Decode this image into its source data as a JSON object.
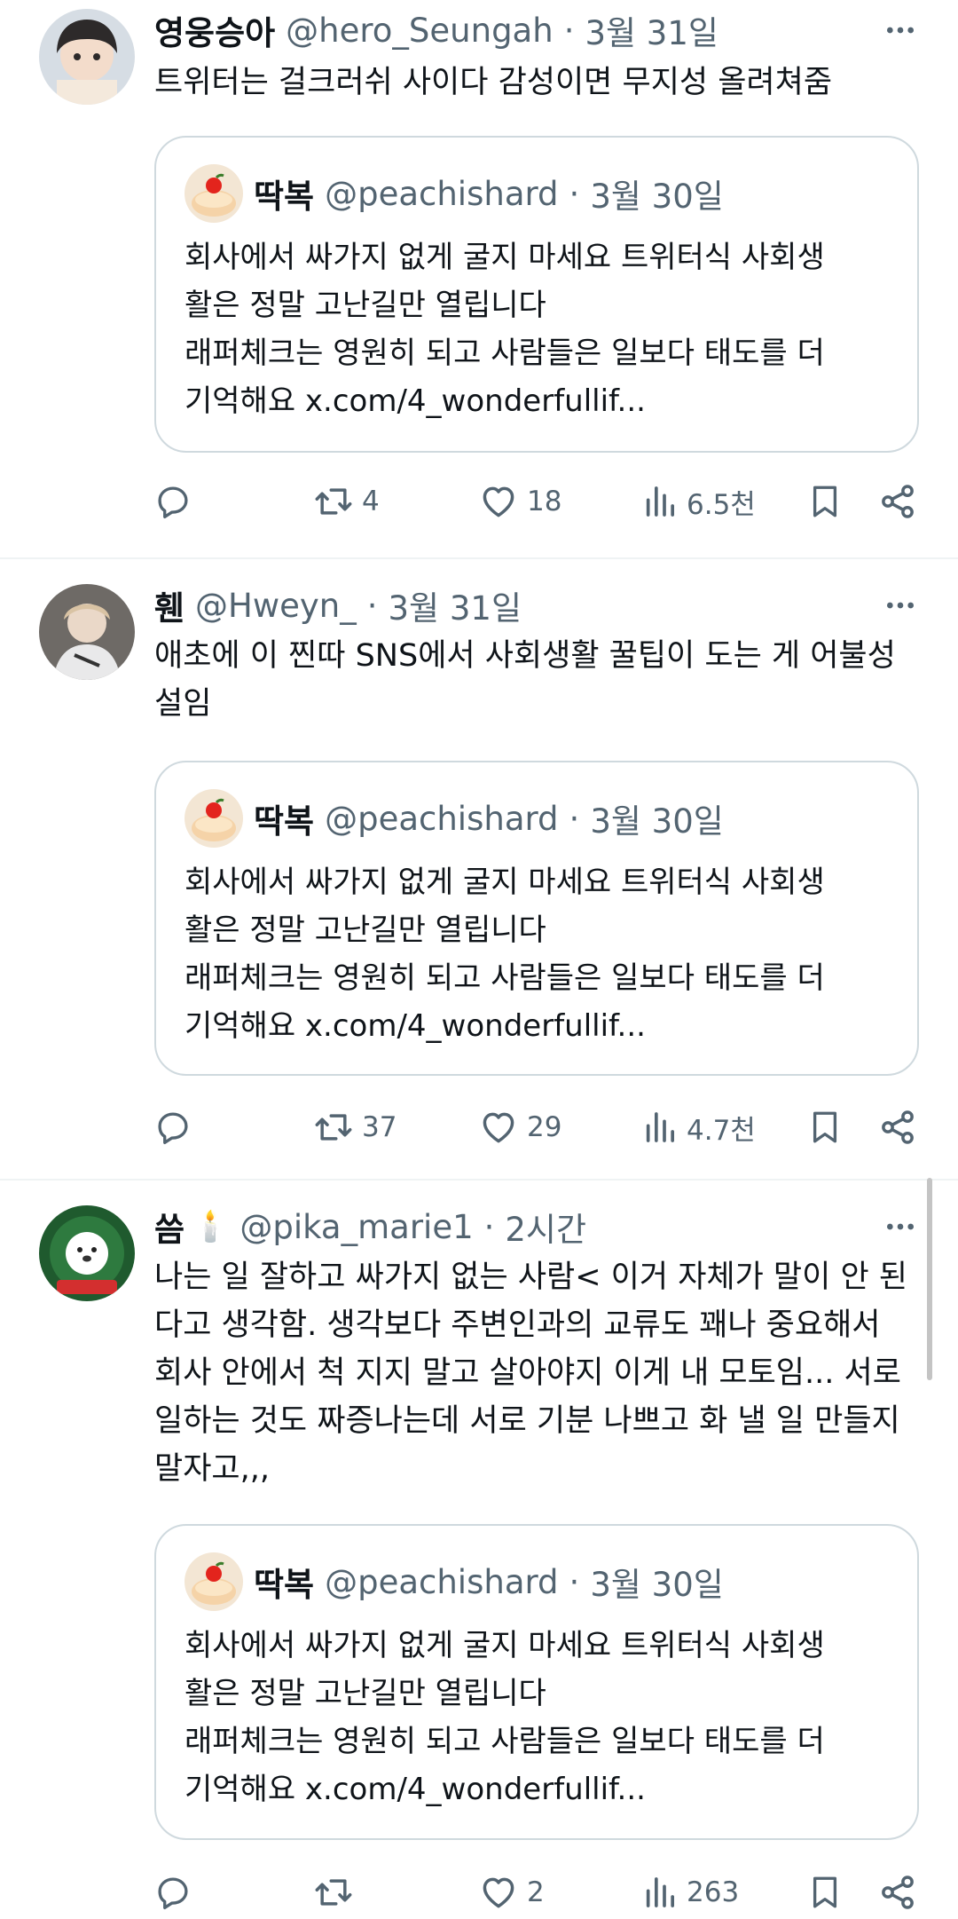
{
  "tweets": [
    {
      "name": "영웅승아",
      "handle": "@hero_Seungah",
      "separator": "·",
      "time": "3월 31일",
      "text": "트위터는 걸크러쉬 사이다 감성이면 무지성 올려쳐줌",
      "quote": {
        "name": "딱복",
        "handle": "@peachishard",
        "separator": "·",
        "time": "3월 30일",
        "text": "회사에서 싸가지 없게 굴지 마세요 트위터식 사회생\n활은 정말 고난길만 열립니다\n래퍼체크는 영원히 되고 사람들은 일보다 태도를 더\n기억해요 x.com/4_wonderfullif..."
      },
      "stats": {
        "replies": "",
        "retweets": "4",
        "likes": "18",
        "views": "6.5천"
      }
    },
    {
      "name": "휀",
      "handle": "@Hweyn_",
      "separator": "·",
      "time": "3월 31일",
      "text": "애초에 이 찐따 SNS에서 사회생활 꿀팁이 도는 게 어불성\n설임",
      "quote": {
        "name": "딱복",
        "handle": "@peachishard",
        "separator": "·",
        "time": "3월 30일",
        "text": "회사에서 싸가지 없게 굴지 마세요 트위터식 사회생\n활은 정말 고난길만 열립니다\n래퍼체크는 영원히 되고 사람들은 일보다 태도를 더\n기억해요 x.com/4_wonderfullif..."
      },
      "stats": {
        "replies": "",
        "retweets": "37",
        "likes": "29",
        "views": "4.7천"
      }
    },
    {
      "name": "씀",
      "name_emoji": "🕯️",
      "handle": "@pika_marie1",
      "separator": "·",
      "time": "2시간",
      "text": "나는 일 잘하고 싸가지 없는 사람< 이거 자체가 말이 안 된\n다고 생각함. 생각보다 주변인과의 교류도 꽤나 중요해서\n회사 안에서 척 지지 말고 살아야지 이게 내 모토임... 서로\n일하는 것도 짜증나는데 서로 기분 나쁘고 화 낼 일 만들지\n말자고,,,",
      "quote": {
        "name": "딱복",
        "handle": "@peachishard",
        "separator": "·",
        "time": "3월 30일",
        "text": "회사에서 싸가지 없게 굴지 마세요 트위터식 사회생\n활은 정말 고난길만 열립니다\n래퍼체크는 영원히 되고 사람들은 일보다 태도를 더\n기억해요 x.com/4_wonderfullif..."
      },
      "stats": {
        "replies": "",
        "retweets": "",
        "likes": "2",
        "views": "263"
      }
    }
  ],
  "icons": {
    "more": "more-icon",
    "reply": "reply-icon",
    "retweet": "retweet-icon",
    "like": "like-icon",
    "views": "views-icon",
    "bookmark": "bookmark-icon",
    "share": "share-icon"
  },
  "colors": {
    "text": "#0f1419",
    "secondary": "#536471",
    "border": "#cfd9de",
    "divider": "#eff3f4"
  }
}
